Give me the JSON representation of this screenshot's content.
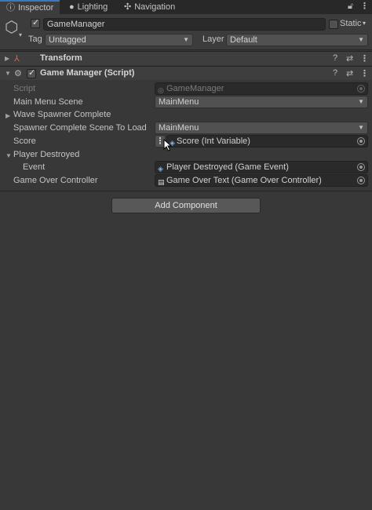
{
  "tabs": [
    {
      "label": "Inspector",
      "icon": "info-icon",
      "active": true
    },
    {
      "label": "Lighting",
      "icon": "lightbulb-icon",
      "active": false
    },
    {
      "label": "Navigation",
      "icon": "navigation-icon",
      "active": false
    }
  ],
  "header": {
    "object_name": "GameManager",
    "static_label": "Static",
    "tag_label": "Tag",
    "tag_value": "Untagged",
    "layer_label": "Layer",
    "layer_value": "Default"
  },
  "components": {
    "transform": {
      "title": "Transform"
    },
    "game_manager": {
      "title": "Game Manager (Script)"
    }
  },
  "properties": {
    "script": {
      "label": "Script",
      "value": "GameManager"
    },
    "main_menu_scene": {
      "label": "Main Menu Scene",
      "value": "MainMenu"
    },
    "wave_spawner_complete": {
      "label": "Wave Spawner Complete"
    },
    "spawner_complete_scene": {
      "label": "Spawner Complete Scene To Load",
      "value": "MainMenu"
    },
    "score": {
      "label": "Score",
      "value": "Score (Int Variable)"
    },
    "player_destroyed": {
      "label": "Player Destroyed"
    },
    "event": {
      "label": "Event",
      "value": "Player Destroyed (Game Event)"
    },
    "game_over_controller": {
      "label": "Game Over Controller",
      "value": "Game Over Text (Game Over Controller)"
    }
  },
  "add_component_label": "Add Component",
  "colors": {
    "background": "#383838",
    "tab_bar": "#282828",
    "accent": "#3a79bb",
    "field": "#2a2a2a"
  }
}
